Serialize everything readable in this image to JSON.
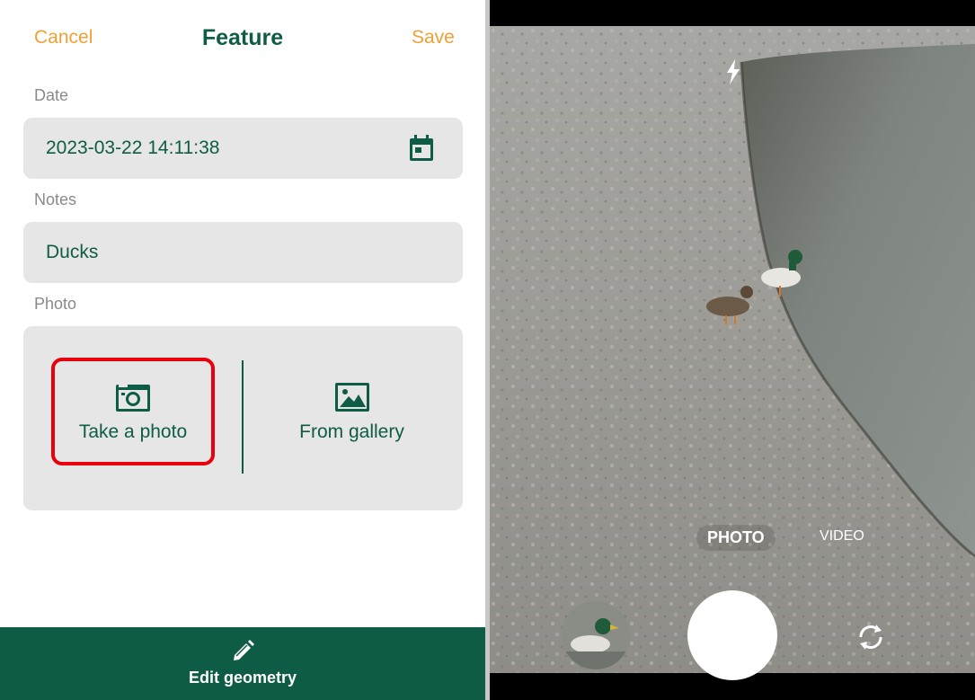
{
  "form": {
    "cancel_label": "Cancel",
    "title": "Feature",
    "save_label": "Save",
    "date_label": "Date",
    "date_value": "2023-03-22 14:11:38",
    "notes_label": "Notes",
    "notes_value": "Ducks",
    "photo_label": "Photo",
    "take_photo_label": "Take a photo",
    "from_gallery_label": "From gallery",
    "edit_geometry_label": "Edit geometry"
  },
  "camera": {
    "mode_photo": "PHOTO",
    "mode_video": "VIDEO"
  },
  "icons": {
    "calendar": "calendar-icon",
    "camera": "camera-icon",
    "gallery": "image-icon",
    "pencil": "pencil-icon",
    "flash": "flash-auto-icon",
    "switch": "switch-camera-icon"
  },
  "colors": {
    "brand_green": "#0e5c45",
    "accent_orange": "#f0a035",
    "highlight_red": "#e8000d",
    "field_bg": "#e6e6e6"
  }
}
